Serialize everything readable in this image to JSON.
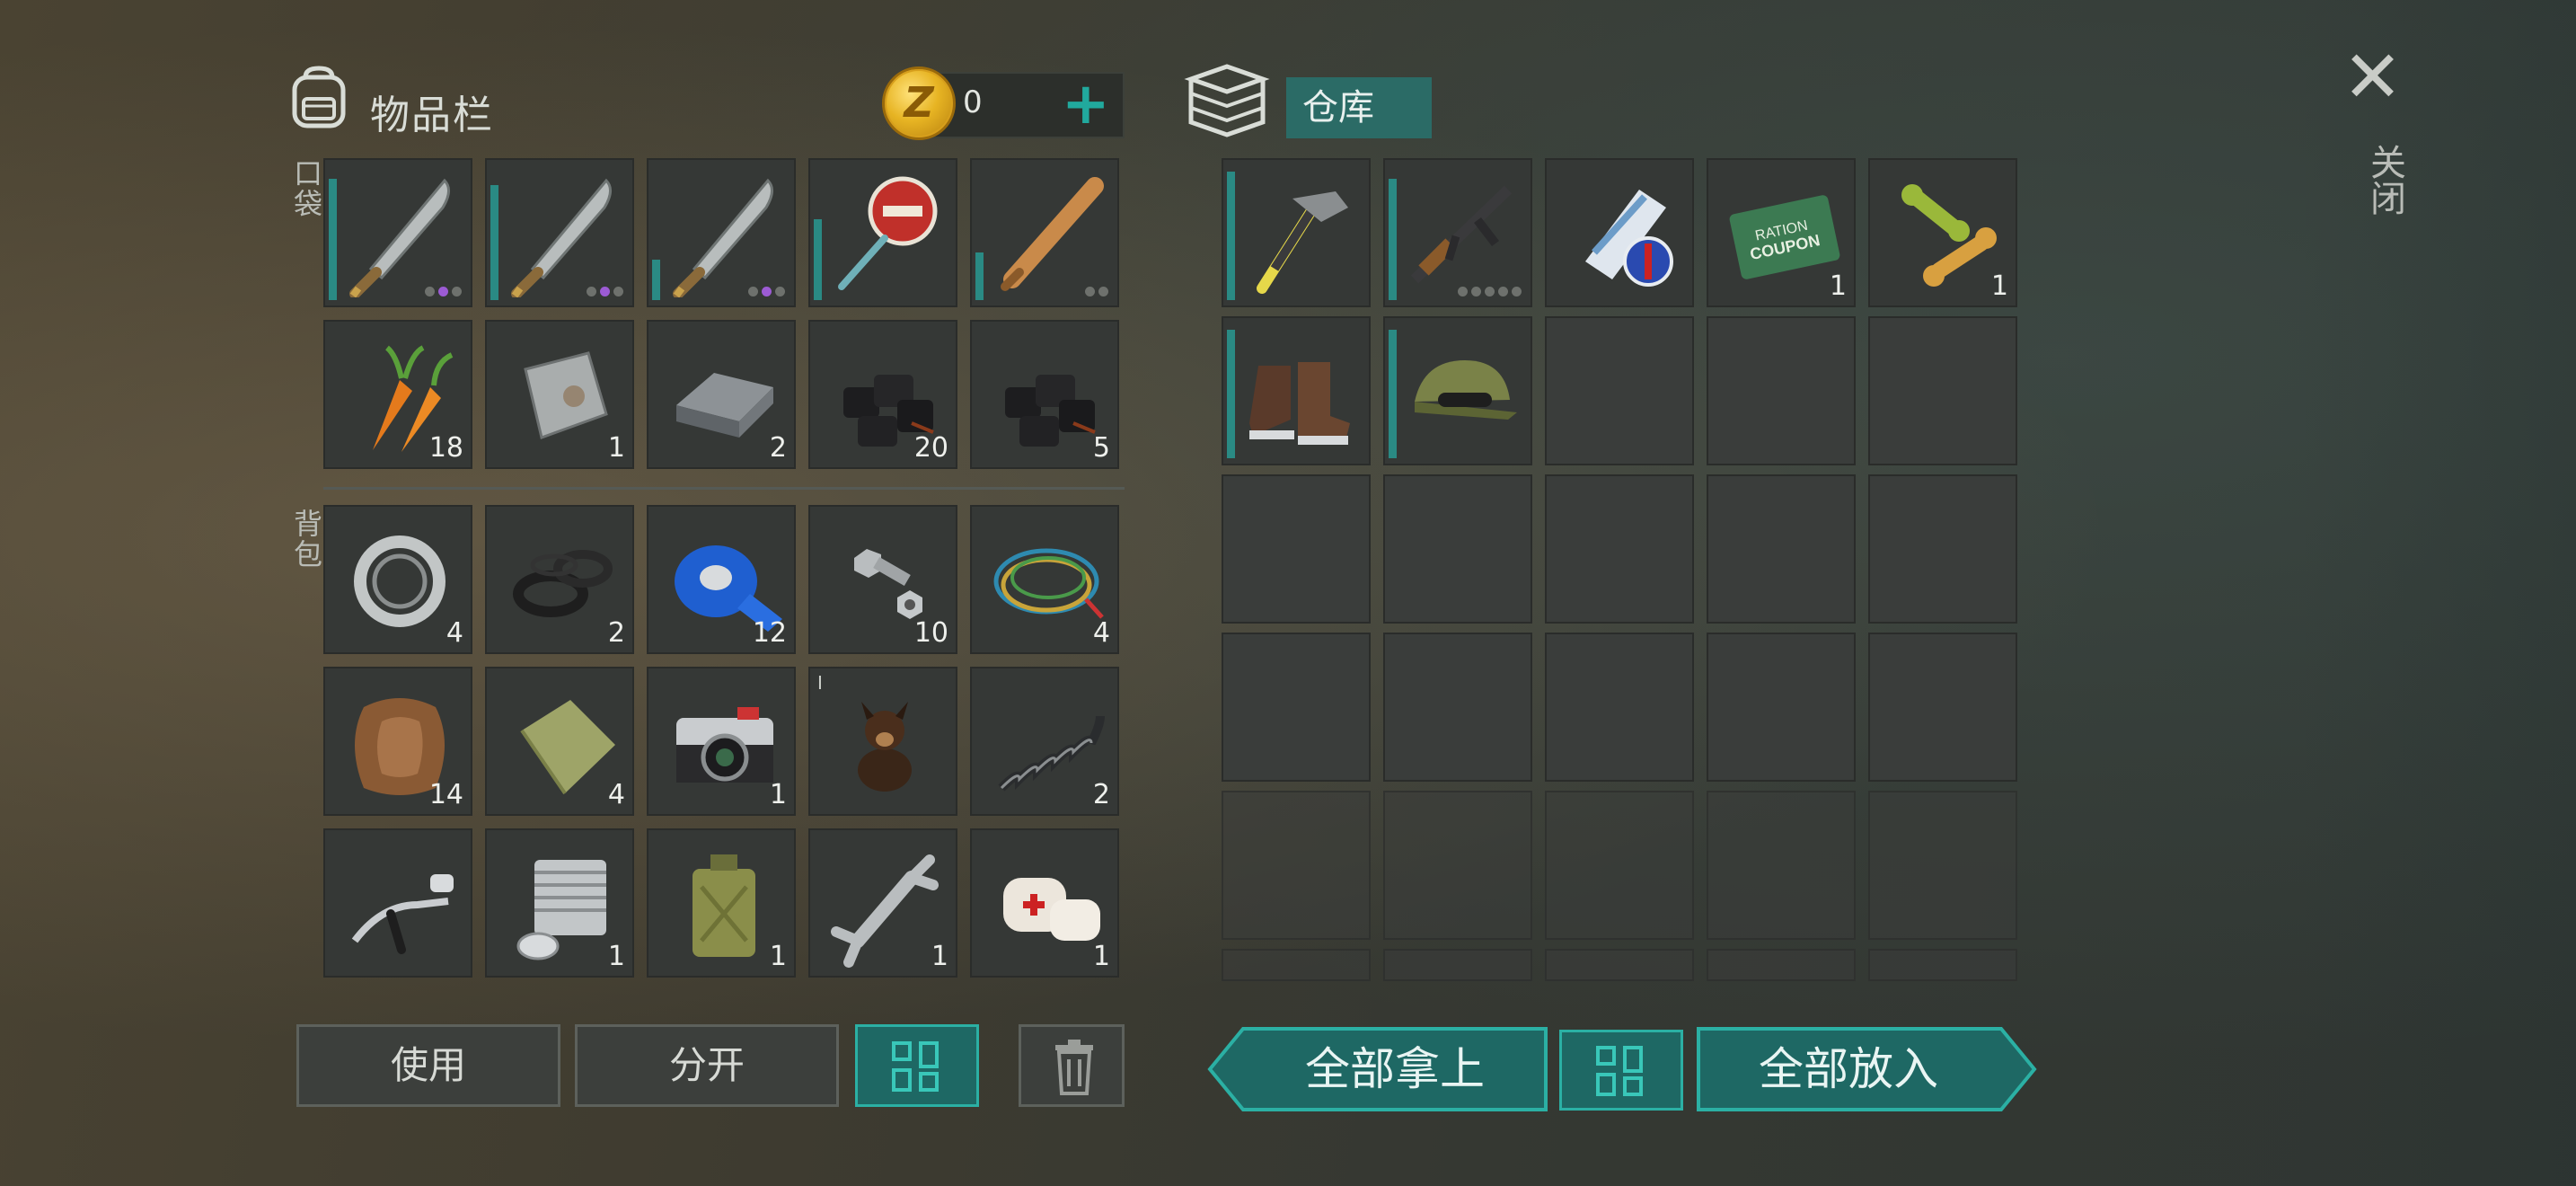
{
  "inventory": {
    "title": "物品栏",
    "icon": "backpack-icon",
    "coins": "0",
    "coin_letter": "Z",
    "pockets_label": "口袋",
    "backpack_label": "背包",
    "pockets": [
      {
        "item": "machete",
        "qty": "",
        "durability": 0.9,
        "dots": [
          "gray",
          "purple",
          "gray"
        ]
      },
      {
        "item": "machete",
        "qty": "",
        "durability": 0.85,
        "dots": [
          "gray",
          "purple",
          "gray"
        ]
      },
      {
        "item": "machete",
        "qty": "",
        "durability": 0.3,
        "dots": [
          "gray",
          "purple",
          "gray"
        ]
      },
      {
        "item": "stop-sign",
        "qty": "",
        "durability": 0.6,
        "dots": []
      },
      {
        "item": "baseball-bat",
        "qty": "",
        "durability": 0.35,
        "dots": [
          "gray",
          "gray"
        ]
      },
      {
        "item": "carrots",
        "qty": "18"
      },
      {
        "item": "metal-plate",
        "qty": "1"
      },
      {
        "item": "iron-ingot",
        "qty": "2"
      },
      {
        "item": "coal",
        "qty": "20"
      },
      {
        "item": "coal",
        "qty": "5"
      }
    ],
    "backpack": [
      {
        "item": "bearing",
        "qty": "4"
      },
      {
        "item": "rubber-seals",
        "qty": "2"
      },
      {
        "item": "duct-tape",
        "qty": "12"
      },
      {
        "item": "bolts-nuts",
        "qty": "10"
      },
      {
        "item": "wires",
        "qty": "4"
      },
      {
        "item": "hide",
        "qty": "14"
      },
      {
        "item": "cloth",
        "qty": "4"
      },
      {
        "item": "camera",
        "qty": "1"
      },
      {
        "item": "dog-figure",
        "qty": "",
        "mini": "I"
      },
      {
        "item": "spring",
        "qty": "2"
      },
      {
        "item": "handlebar",
        "qty": ""
      },
      {
        "item": "engine-cylinder",
        "qty": "1"
      },
      {
        "item": "jerry-can",
        "qty": "1"
      },
      {
        "item": "wrench",
        "qty": "1"
      },
      {
        "item": "bandages",
        "qty": "1"
      }
    ]
  },
  "storage": {
    "title": "仓库",
    "icon": "storage-boxes-icon",
    "items": [
      {
        "item": "hammer",
        "qty": "",
        "durability": 0.95
      },
      {
        "item": "rifle",
        "qty": "",
        "durability": 0.9,
        "dots": [
          "gray",
          "gray",
          "gray",
          "gray",
          "gray"
        ]
      },
      {
        "item": "rolled-poster",
        "qty": ""
      },
      {
        "item": "ration-coupon",
        "qty": "1",
        "text": "RATION COUPON"
      },
      {
        "item": "dog-bones",
        "qty": "1"
      },
      {
        "item": "boots",
        "qty": "",
        "durability": 0.95
      },
      {
        "item": "camo-cap",
        "qty": "",
        "durability": 0.95
      }
    ],
    "total_slots": 30
  },
  "actions": {
    "use": "使用",
    "split": "分开",
    "take_all": "全部拿上",
    "put_all": "全部放入"
  },
  "close": {
    "icon": "close-icon",
    "label": "关闭"
  },
  "colors": {
    "accent": "#2bb0a4",
    "accent_dark": "#1e6864",
    "slot_bg": "#353836",
    "rarity_purple": "#9c5bd4"
  }
}
